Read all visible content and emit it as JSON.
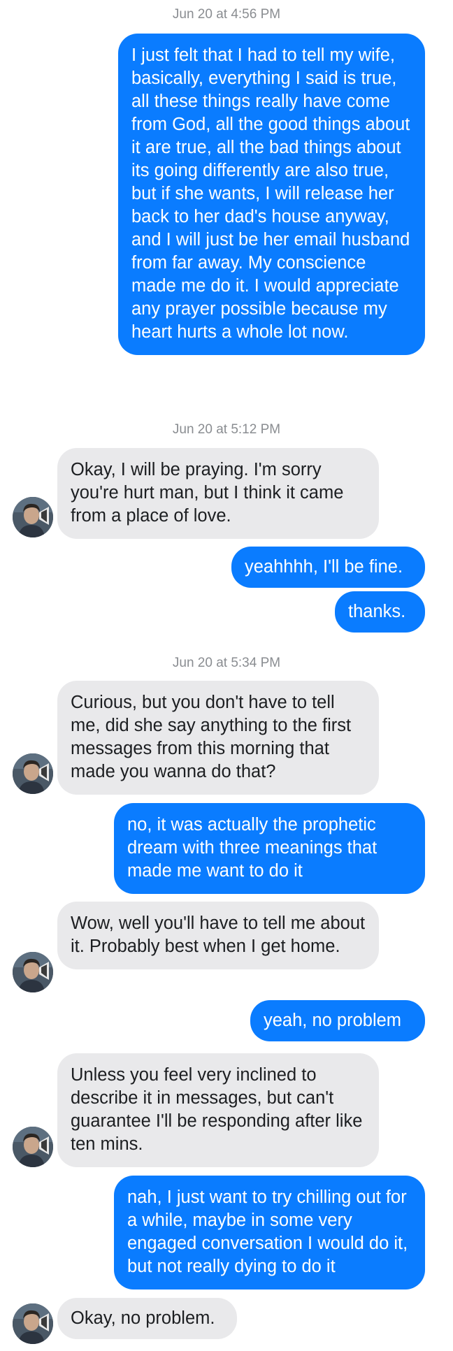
{
  "conversation": {
    "timestamps": [
      "Jun 20 at 4:56 PM",
      "Jun 20 at 5:12 PM",
      "Jun 20 at 5:34 PM"
    ],
    "messages": [
      {
        "sender": "me",
        "text": "I just felt that I had to tell my wife, basically, everything I said is true, all these things really have come from God, all the good things about it are true, all the bad things about its going differently are also true, but if she wants, I will release her back to her dad's house anyway, and I will just be her email husband from far away. My conscience made me do it. I would appreciate any prayer possible because my heart hurts a whole lot now."
      },
      {
        "sender": "contact",
        "text": "Okay, I will be praying. I'm sorry you're hurt man, but I think it came from a place of love."
      },
      {
        "sender": "me",
        "text": "yeahhhh, I'll be fine."
      },
      {
        "sender": "me",
        "text": "thanks."
      },
      {
        "sender": "contact",
        "text": "Curious, but you don't have to tell me, did she say anything to the first messages from this morning that made you wanna do that?"
      },
      {
        "sender": "me",
        "text": "no, it was actually the prophetic dream with three meanings that made me want to do it"
      },
      {
        "sender": "contact",
        "text": "Wow, well you'll have to tell me about it. Probably best when I get home."
      },
      {
        "sender": "me",
        "text": "yeah, no problem"
      },
      {
        "sender": "contact",
        "text": "Unless you feel very inclined to describe it in messages, but can't guarantee I'll be responding after like ten mins."
      },
      {
        "sender": "me",
        "text": "nah, I just want to try chilling out for a while, maybe in some very engaged conversation I would do it, but not really dying to do it"
      },
      {
        "sender": "contact",
        "text": "Okay, no problem."
      }
    ]
  },
  "colors": {
    "outgoing_bubble": "#0a7cff",
    "incoming_bubble": "#e9e9eb",
    "timestamp_text": "#8a8d91"
  },
  "icons": {
    "avatar": "contact-avatar-photo"
  }
}
